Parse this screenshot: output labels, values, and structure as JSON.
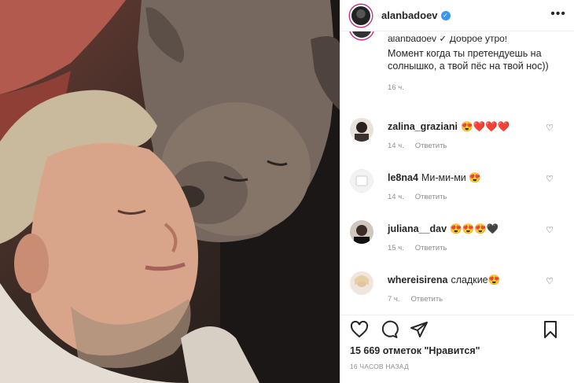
{
  "header": {
    "username": "alanbadoev",
    "more_label": "•••"
  },
  "caption": {
    "clipped_line": "alanbadoev ✓ Доброе утро!",
    "text": "Момент когда ты претендуешь на солнышко, а твой пёс на твой нос))",
    "time": "16 ч."
  },
  "comments": [
    {
      "user": "zalina_graziani",
      "text": "😍❤️❤️❤️",
      "time": "14 ч.",
      "reply": "Ответить"
    },
    {
      "user": "le8na4",
      "text": "Ми-ми-ми 😍",
      "time": "14 ч.",
      "reply": "Ответить"
    },
    {
      "user": "juliana__dav",
      "text": "😍😍😍🖤",
      "time": "15 ч.",
      "reply": "Ответить"
    },
    {
      "user": "whereisirena",
      "text": "сладкие😍",
      "time": "7 ч.",
      "reply": "Ответить"
    }
  ],
  "actions": {
    "likes": "15 669 отметок \"Нравится\"",
    "posted": "16 часов назад"
  },
  "colors": {
    "verified": "#3897f0",
    "story_ring": "#c13584",
    "muted_text": "#8e8e8e"
  }
}
